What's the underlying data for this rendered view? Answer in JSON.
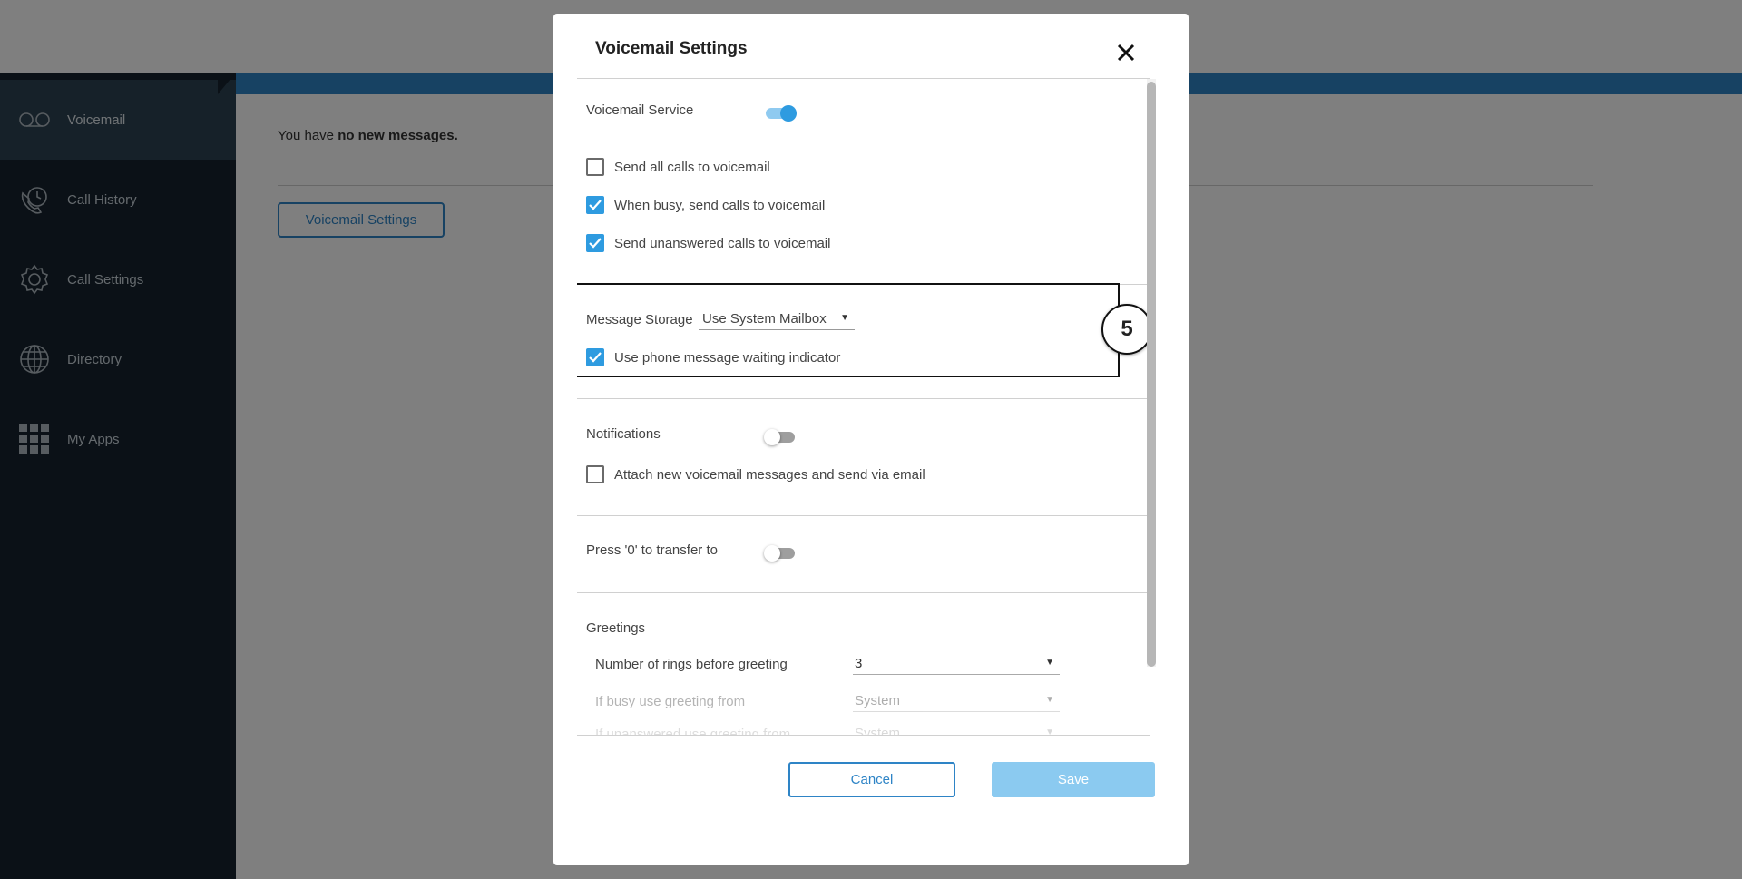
{
  "sidebar": {
    "items": [
      {
        "label": "Voicemail",
        "icon": "voicemail-icon",
        "active": true
      },
      {
        "label": "Call History",
        "icon": "call-history-icon"
      },
      {
        "label": "Call Settings",
        "icon": "gear-icon"
      },
      {
        "label": "Directory",
        "icon": "globe-icon"
      },
      {
        "label": "My Apps",
        "icon": "apps-grid-icon"
      }
    ]
  },
  "main": {
    "message_prefix": "You have ",
    "message_bold": "no new messages.",
    "settings_button_label": "Voicemail Settings"
  },
  "modal": {
    "title": "Voicemail Settings",
    "close_icon": "close-icon",
    "voicemail_service": {
      "label": "Voicemail Service",
      "enabled": true,
      "options": [
        {
          "label": "Send all calls to voicemail",
          "checked": false
        },
        {
          "label": "When busy, send calls to voicemail",
          "checked": true
        },
        {
          "label": "Send unanswered calls to voicemail",
          "checked": true
        }
      ]
    },
    "message_storage": {
      "label": "Message Storage",
      "selected": "Use System Mailbox",
      "mwi_label": "Use phone message waiting indicator",
      "mwi_checked": true
    },
    "callout_number": "5",
    "notifications": {
      "label": "Notifications",
      "enabled": false,
      "attach_label": "Attach new voicemail messages and send via email",
      "attach_checked": false
    },
    "press_zero": {
      "label": "Press '0' to transfer to",
      "enabled": false
    },
    "greetings": {
      "label": "Greetings",
      "rings_label": "Number of rings before greeting",
      "rings_value": "3",
      "busy_label": "If busy use greeting from",
      "busy_value": "System",
      "unanswered_label": "If unanswered use greeting from",
      "unanswered_value": "System"
    },
    "cancel_label": "Cancel",
    "save_label": "Save"
  },
  "colors": {
    "accent": "#2e84c6",
    "toggle_on": "#2e9be0",
    "sidebar_bg": "#16232e",
    "sidebar_active": "#2d4252",
    "save_disabled": "#8bcaf0"
  }
}
